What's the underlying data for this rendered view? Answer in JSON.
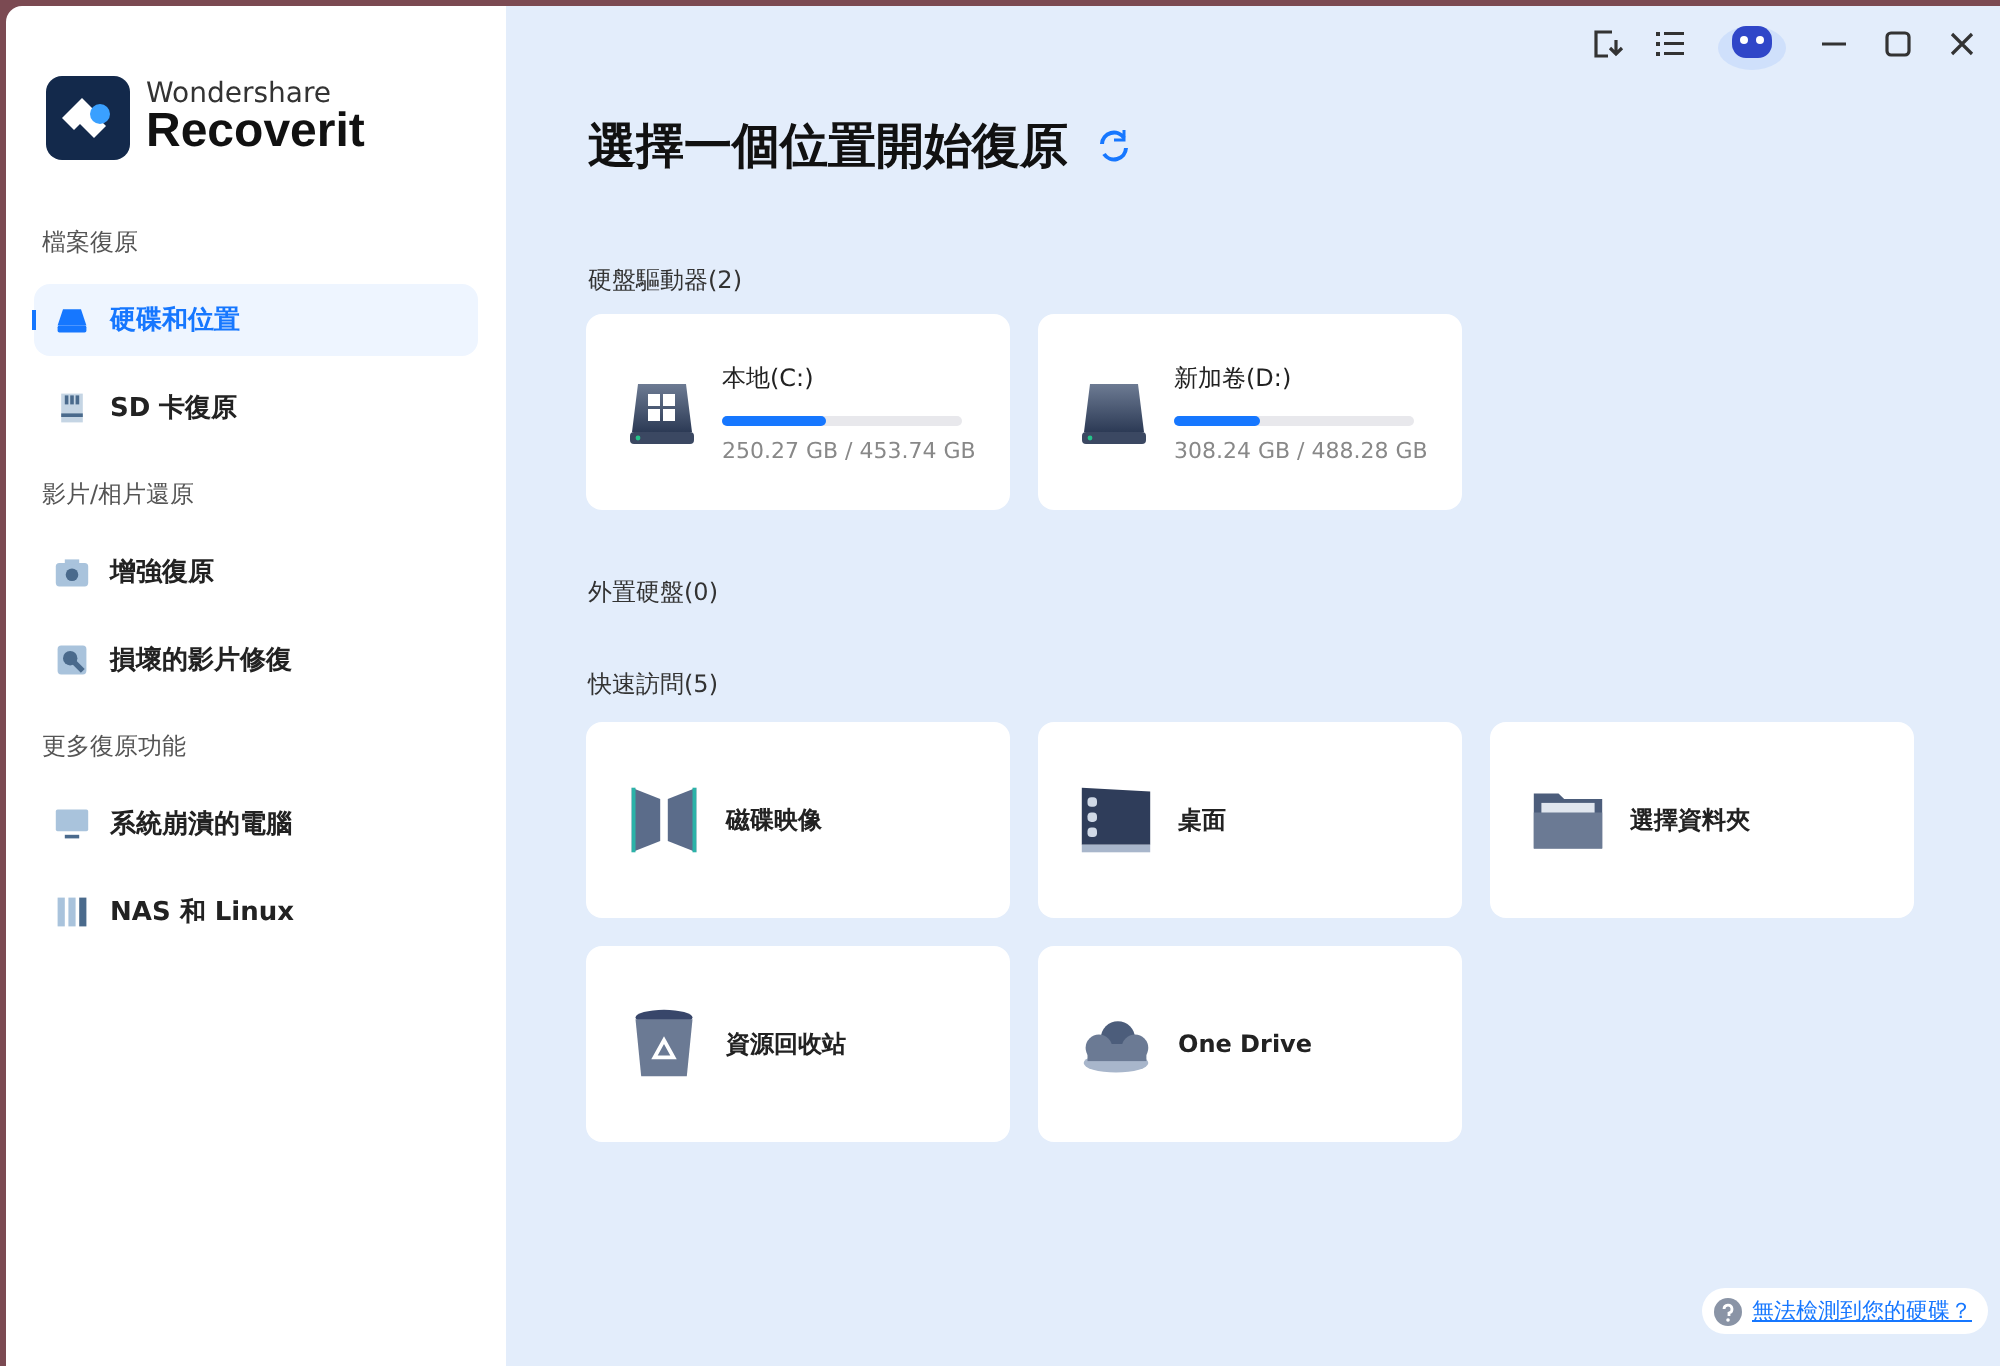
{
  "brand": {
    "line1": "Wondershare",
    "line2": "Recoverit"
  },
  "sidebar": {
    "groups": [
      {
        "title": "檔案復原",
        "items": [
          {
            "label": "硬碟和位置",
            "kind": "drive",
            "selected": true
          },
          {
            "label": "SD 卡復原",
            "kind": "sd",
            "selected": false
          }
        ]
      },
      {
        "title": "影片/相片還原",
        "items": [
          {
            "label": "增強復原",
            "kind": "camera",
            "selected": false
          },
          {
            "label": "損壞的影片修復",
            "kind": "repair",
            "selected": false
          }
        ]
      },
      {
        "title": "更多復原功能",
        "items": [
          {
            "label": "系統崩潰的電腦",
            "kind": "monitor",
            "selected": false
          },
          {
            "label": "NAS 和 Linux",
            "kind": "nas",
            "selected": false
          }
        ]
      }
    ]
  },
  "heading": "選擇一個位置開始復原",
  "drives_section": {
    "title": "硬盤驅動器(2)",
    "drives": [
      {
        "name": "本地(C:)",
        "kind": "windows",
        "level": 0.43,
        "usage": "250.27 GB / 453.74 GB"
      },
      {
        "name": "新加卷(D:)",
        "kind": "plain",
        "level": 0.36,
        "usage": "308.24 GB / 488.28 GB"
      }
    ]
  },
  "external_section": {
    "title": "外置硬盤(0)"
  },
  "quick_section": {
    "title": "快速訪問(5)",
    "items": [
      {
        "label": "磁碟映像",
        "kind": "image"
      },
      {
        "label": "桌面",
        "kind": "desktop"
      },
      {
        "label": "選擇資料夾",
        "kind": "folder"
      },
      {
        "label": "資源回收站",
        "kind": "bin"
      },
      {
        "label": "One Drive",
        "kind": "cloud"
      }
    ]
  },
  "help_link": "無法檢測到您的硬碟？"
}
